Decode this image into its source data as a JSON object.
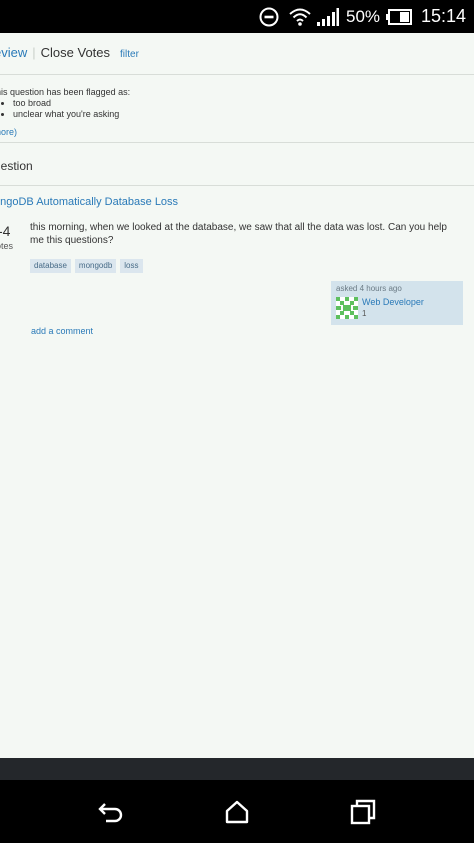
{
  "status_bar": {
    "battery_percent": "50%",
    "time": "15:14",
    "icons": [
      "do-not-disturb-icon",
      "wifi-icon",
      "signal-icon",
      "battery-icon"
    ]
  },
  "top_nav": {
    "review_label": "eview",
    "current_label": "Close Votes",
    "filter_label": "filter"
  },
  "flag_notice": {
    "intro": "his question has been flagged as:",
    "reasons": [
      "too broad",
      "unclear what you're asking"
    ],
    "more_label": "nore)"
  },
  "section_heading": "uestion",
  "question": {
    "title": "ongoDB Automatically Database Loss",
    "vote_count": "-4",
    "vote_label": "otes",
    "body": "this morning, when we looked at the database, we saw that all the data was lost. Can you help me this questions?",
    "tags": [
      "database",
      "mongodb",
      "loss"
    ],
    "asked": "asked 4 hours ago",
    "user_name": "Web Developer",
    "user_rep": "1",
    "add_comment_label": "add a comment"
  },
  "colors": {
    "page_background": "#f4f8f4",
    "link": "#2a7ab8",
    "tag_background": "#dbe6ee",
    "owner_card_background": "#d3e3ec",
    "identicon": "#5ec05e"
  },
  "nav_bar": {
    "icons": [
      "back-icon",
      "home-icon",
      "recent-apps-icon"
    ]
  }
}
